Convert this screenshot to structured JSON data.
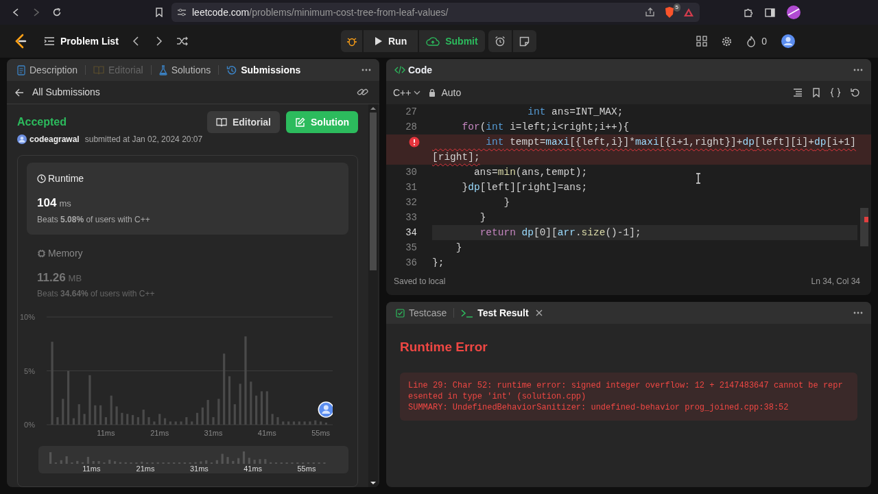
{
  "browser": {
    "url_host": "leetcode.com",
    "url_path": "/problems/minimum-cost-tree-from-leaf-values/",
    "extension_badge": "5"
  },
  "topbar": {
    "problem_list": "Problem List",
    "run": "Run",
    "submit": "Submit",
    "streak": "0"
  },
  "left_panel": {
    "tabs": [
      {
        "kind": "description",
        "label": "Description",
        "selected": false,
        "disabled": false
      },
      {
        "kind": "editorial",
        "label": "Editorial",
        "selected": false,
        "disabled": true
      },
      {
        "kind": "solutions",
        "label": "Solutions",
        "selected": false,
        "disabled": false
      },
      {
        "kind": "submissions",
        "label": "Submissions",
        "selected": true,
        "disabled": false
      }
    ],
    "back_link": "All Submissions",
    "status": "Accepted",
    "user": "codeagrawal",
    "submitted": "submitted at Jan 02, 2024 20:07",
    "buttons": [
      {
        "kind": "editorial",
        "label": "Editorial"
      },
      {
        "kind": "solution",
        "label": "Solution"
      }
    ],
    "stats": [
      {
        "kind": "runtime",
        "label": "Runtime",
        "value": "104",
        "unit": "ms",
        "beats": "Beats **5.08%** of users with C++",
        "selected": true
      },
      {
        "kind": "memory",
        "label": "Memory",
        "value": "11.26",
        "unit": "MB",
        "beats": "Beats **34.64%** of users with C++",
        "selected": false
      }
    ],
    "chart_data": {
      "type": "bar",
      "categories": [
        null,
        null,
        null,
        null,
        null,
        null,
        null,
        null,
        null,
        null,
        "11ms",
        null,
        null,
        null,
        null,
        null,
        null,
        null,
        null,
        null,
        "21ms",
        null,
        null,
        null,
        null,
        null,
        null,
        null,
        null,
        null,
        "31ms",
        null,
        null,
        null,
        null,
        null,
        null,
        null,
        null,
        null,
        "41ms",
        null,
        null,
        null,
        null,
        null,
        null,
        null,
        null,
        null,
        "55ms",
        null
      ],
      "series": [
        {
          "color": "#4a4a4a",
          "values": [
            7.7,
            0.7,
            2.4,
            5.0,
            0.6,
            1.9,
            1.0,
            4.6,
            1.8,
            1.8,
            0.7,
            2.7,
            1.7,
            1.1,
            1.0,
            0.9,
            0.7,
            1.4,
            0.7,
            0.3,
            1.0,
            0.6,
            0.3,
            0.3,
            0.3,
            0.7,
            0.3,
            1.1,
            1.6,
            2.3,
            0.7,
            2.4,
            6.6,
            4.5,
            1.9,
            3.8,
            8.2,
            4.0,
            2.7,
            3.1,
            3.1,
            1.0,
            0.7,
            0.3,
            0.3,
            0.3,
            0.3,
            0.3,
            0.3,
            0.4,
            0.3,
            0.2
          ]
        }
      ],
      "ylim": [
        0,
        10
      ],
      "yticks": [
        {
          "value": 0,
          "label": "0%"
        },
        {
          "value": 5,
          "label": "5%"
        },
        {
          "value": 10,
          "label": "10%"
        }
      ]
    },
    "navigator_labels": [
      "11ms",
      "21ms",
      "31ms",
      "41ms",
      "55ms"
    ]
  },
  "code_panel": {
    "title": "Code",
    "language": "C++",
    "mode": "Auto",
    "lines": [
      {
        "number": "27",
        "error": false,
        "current": false,
        "tokens": [
          {
            "kind": "type",
            "text": "                int"
          },
          {
            "kind": "plain",
            "text": " ans=INT_MAX;"
          }
        ]
      },
      {
        "number": "28",
        "error": false,
        "current": false,
        "tokens": [
          {
            "kind": "control",
            "text": "     for"
          },
          {
            "kind": "plain",
            "text": "("
          },
          {
            "kind": "type",
            "text": "int"
          },
          {
            "kind": "plain",
            "text": " i=left;i<right;i++){"
          }
        ]
      },
      {
        "error": true,
        "current": false,
        "tokens": [
          {
            "kind": "type",
            "text": "         int"
          },
          {
            "kind": "plain",
            "text": " tempt="
          },
          {
            "kind": "ident",
            "text": "maxi"
          },
          {
            "kind": "plain",
            "text": "[{left,i}]*"
          },
          {
            "kind": "ident",
            "text": "maxi"
          },
          {
            "kind": "plain",
            "text": "[{i+1,right}]+"
          },
          {
            "kind": "ident",
            "text": "dp"
          },
          {
            "kind": "plain",
            "text": "[left][i]+"
          },
          {
            "kind": "ident",
            "text": "dp"
          },
          {
            "kind": "plain",
            "text": "[i+1][right];"
          }
        ]
      },
      {
        "number": "30",
        "error": false,
        "current": false,
        "tokens": [
          {
            "kind": "plain",
            "text": "       ans="
          },
          {
            "kind": "fn",
            "text": "min"
          },
          {
            "kind": "plain",
            "text": "(ans,tempt);"
          }
        ]
      },
      {
        "number": "31",
        "error": false,
        "current": false,
        "tokens": [
          {
            "kind": "plain",
            "text": "     }"
          },
          {
            "kind": "ident",
            "text": "dp"
          },
          {
            "kind": "plain",
            "text": "[left][right]=ans;"
          }
        ]
      },
      {
        "number": "32",
        "error": false,
        "current": false,
        "tokens": [
          {
            "kind": "plain",
            "text": "            }"
          }
        ]
      },
      {
        "number": "33",
        "error": false,
        "current": false,
        "tokens": [
          {
            "kind": "plain",
            "text": "        }"
          }
        ]
      },
      {
        "number": "34",
        "error": false,
        "current": true,
        "tokens": [
          {
            "kind": "control",
            "text": "        return"
          },
          {
            "kind": "ident",
            "text": " dp"
          },
          {
            "kind": "plain",
            "text": "[0]["
          },
          {
            "kind": "ident",
            "text": "arr"
          },
          {
            "kind": "plain",
            "text": "."
          },
          {
            "kind": "fn",
            "text": "size"
          },
          {
            "kind": "plain",
            "text": "()-1];"
          }
        ]
      },
      {
        "number": "35",
        "error": false,
        "current": false,
        "tokens": [
          {
            "kind": "plain",
            "text": "    }"
          }
        ]
      },
      {
        "number": "36",
        "error": false,
        "current": false,
        "tokens": [
          {
            "kind": "plain",
            "text": "};"
          }
        ]
      }
    ],
    "status": "Saved to local",
    "position": "Ln 34, Col 34"
  },
  "result_panel": {
    "tabs": [
      {
        "kind": "testcase",
        "label": "Testcase",
        "selected": false,
        "closable": false
      },
      {
        "kind": "result",
        "label": "Test Result",
        "selected": true,
        "closable": true
      }
    ],
    "title": "Runtime Error",
    "messages": [
      "Line 29: Char 52: runtime error: signed integer overflow: 12 + 2147483647 cannot be represented in type 'int' (solution.cpp)",
      "SUMMARY: UndefinedBehaviorSanitizer: undefined-behavior prog_joined.cpp:38:52"
    ]
  }
}
